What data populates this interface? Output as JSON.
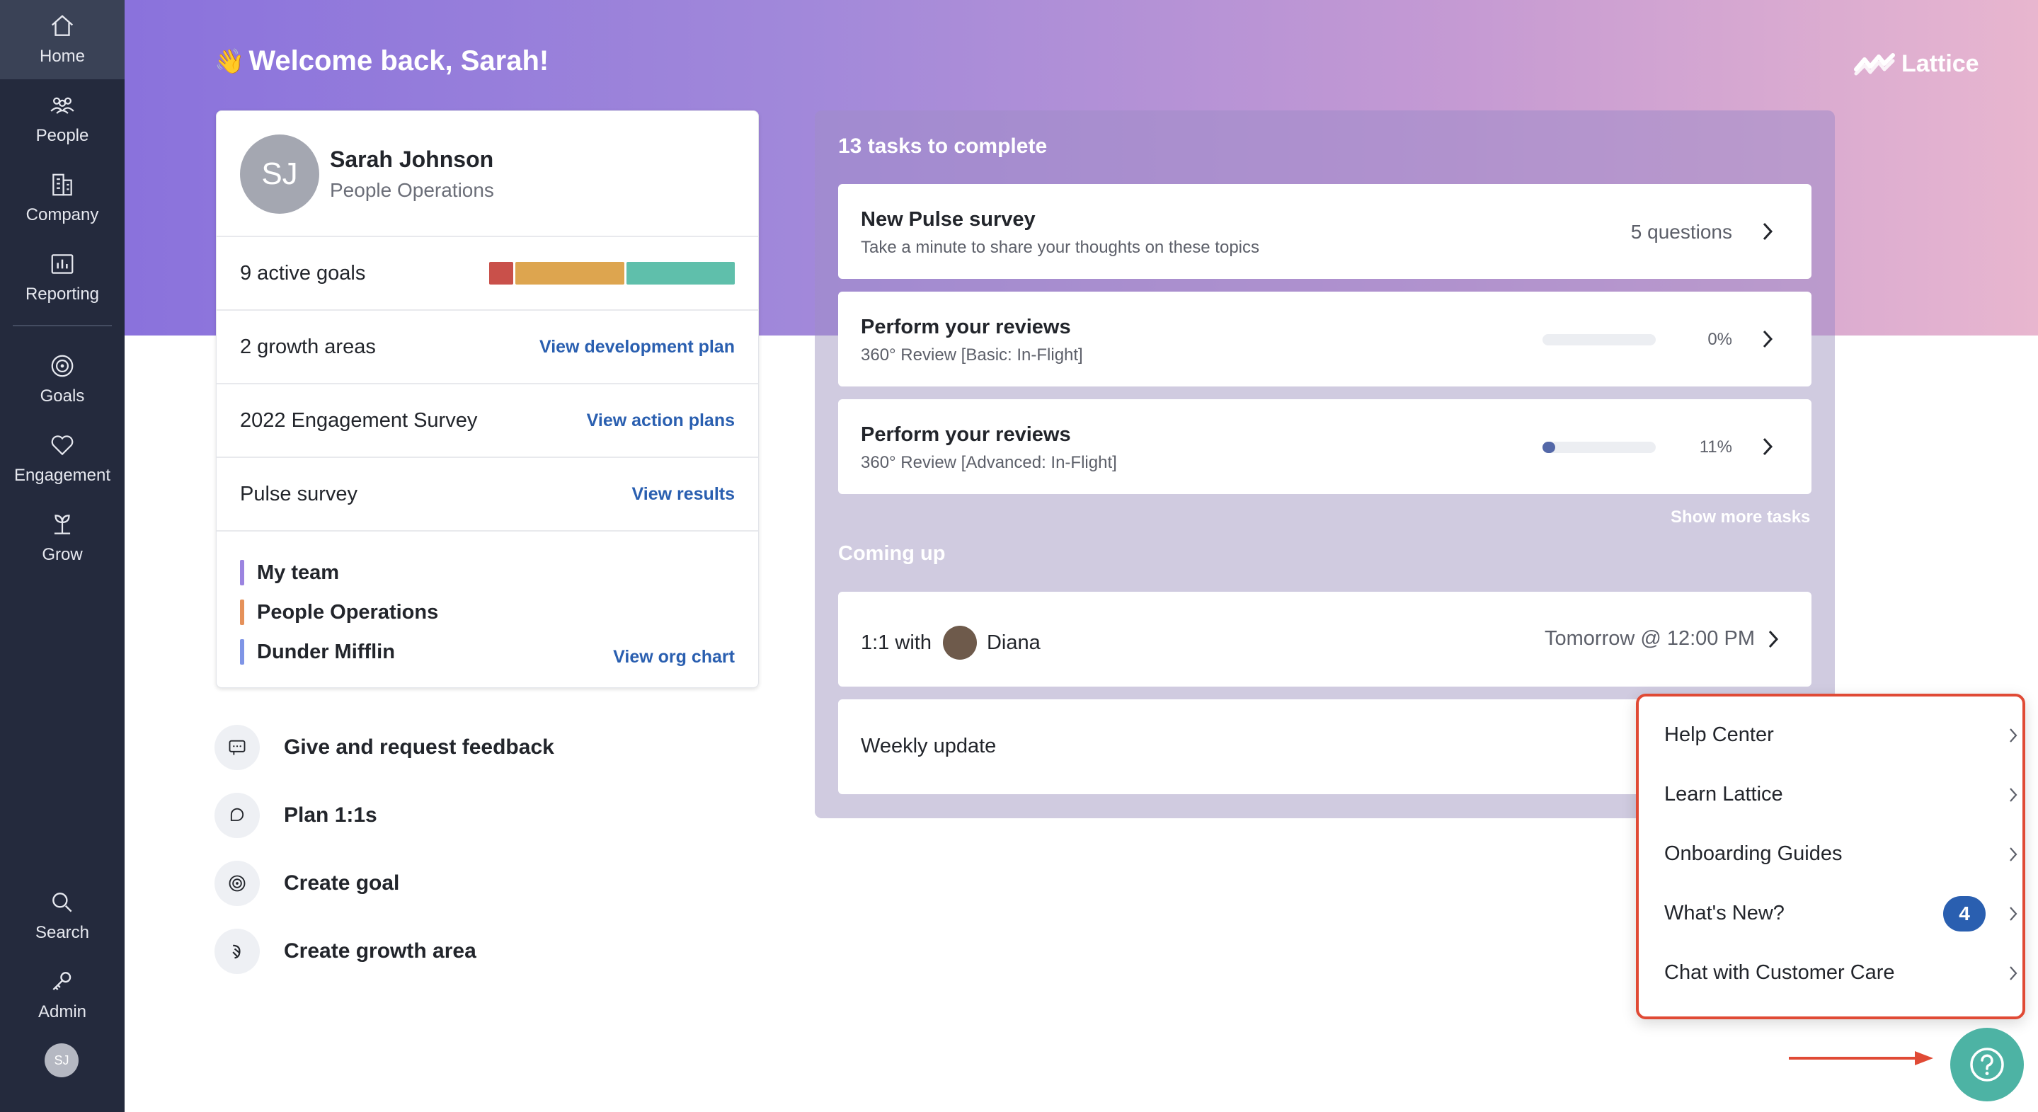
{
  "sidebar": {
    "items": [
      {
        "label": "Home",
        "icon": "home-icon"
      },
      {
        "label": "People",
        "icon": "people-icon"
      },
      {
        "label": "Company",
        "icon": "company-icon"
      },
      {
        "label": "Reporting",
        "icon": "reporting-icon"
      },
      {
        "label": "Goals",
        "icon": "goals-icon"
      },
      {
        "label": "Engagement",
        "icon": "engagement-icon"
      },
      {
        "label": "Grow",
        "icon": "grow-icon"
      },
      {
        "label": "Search",
        "icon": "search-icon"
      },
      {
        "label": "Admin",
        "icon": "admin-key-icon"
      }
    ],
    "avatar_initials": "SJ"
  },
  "header": {
    "welcome": "Welcome back, Sarah!",
    "wave_emoji": "👋",
    "brand": "Lattice"
  },
  "profile": {
    "initials": "SJ",
    "name": "Sarah Johnson",
    "role": "People Operations",
    "goals_label": "9 active goals",
    "goal_colors": [
      "#c9504a",
      "#dda54f",
      "#5fbfab"
    ],
    "growth_label": "2 growth areas",
    "growth_link": "View development plan",
    "survey_label": "2022 Engagement Survey",
    "survey_link": "View action plans",
    "pulse_label": "Pulse survey",
    "pulse_link": "View results",
    "teams": [
      {
        "name": "My team",
        "color": "#9b84e0"
      },
      {
        "name": "People Operations",
        "color": "#e5915a"
      },
      {
        "name": "Dunder Mifflin",
        "color": "#7f95e6"
      }
    ],
    "org_link": "View org chart"
  },
  "quick_actions": [
    {
      "label": "Give and request feedback",
      "icon": "feedback-icon"
    },
    {
      "label": "Plan 1:1s",
      "icon": "chat-bubble-icon"
    },
    {
      "label": "Create goal",
      "icon": "target-icon"
    },
    {
      "label": "Create growth area",
      "icon": "growth-icon"
    }
  ],
  "tasks": {
    "title": "13 tasks to complete",
    "items": [
      {
        "title": "New Pulse survey",
        "subtitle": "Take a minute to share your thoughts on these topics",
        "meta": "5 questions"
      },
      {
        "title": "Perform your reviews",
        "subtitle": "360° Review [Basic: In-Flight]",
        "percent_label": "0%",
        "progress": 0
      },
      {
        "title": "Perform your reviews",
        "subtitle": "360° Review [Advanced: In-Flight]",
        "percent_label": "11%",
        "progress": 0.11
      }
    ],
    "show_more": "Show more tasks"
  },
  "coming_up": {
    "title": "Coming up",
    "oneone_prefix": "1:1 with",
    "oneone_person": "Diana",
    "oneone_when": "Tomorrow @ 12:00 PM",
    "weekly_update": "Weekly update"
  },
  "help_menu": {
    "items": [
      {
        "label": "Help Center"
      },
      {
        "label": "Learn Lattice"
      },
      {
        "label": "Onboarding Guides"
      },
      {
        "label": "What's New?",
        "badge": "4"
      },
      {
        "label": "Chat with Customer Care"
      }
    ]
  },
  "colors": {
    "accent": "#2a5fb0",
    "help_button": "#4db3a4",
    "highlight": "#e04a35"
  }
}
